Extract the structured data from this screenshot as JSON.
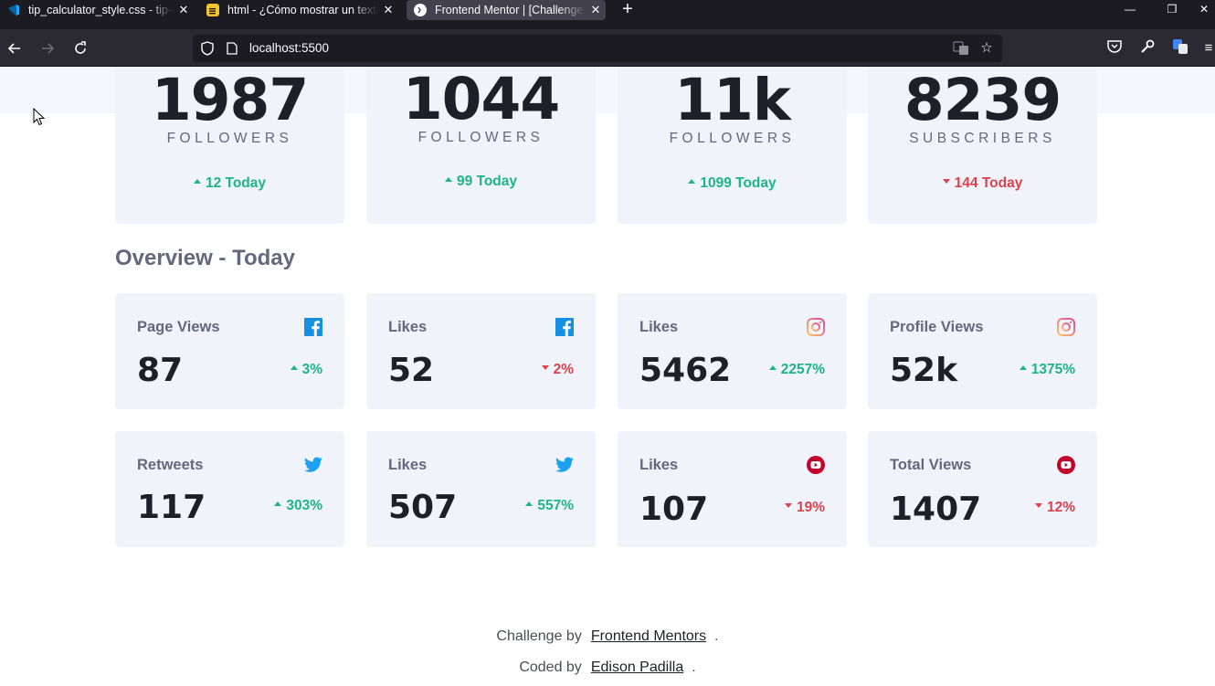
{
  "browser": {
    "tabs": [
      {
        "title": "tip_calculator_style.css - tip-calc",
        "icon": "vscode-icon",
        "active": false
      },
      {
        "title": "html - ¿Cómo mostrar un texto",
        "icon": "stackoverflow-icon",
        "active": false
      },
      {
        "title": "Frontend Mentor | [Challenge N",
        "icon": "frontend-mentor-icon",
        "active": true
      }
    ],
    "url": "localhost:5500"
  },
  "followers": [
    {
      "platform": "facebook",
      "count": "1987",
      "label": "FOLLOWERS",
      "today": "12 Today",
      "trend": "up"
    },
    {
      "platform": "twitter",
      "count": "1044",
      "label": "FOLLOWERS",
      "today": "99 Today",
      "trend": "up"
    },
    {
      "platform": "instagram",
      "count": "11k",
      "label": "FOLLOWERS",
      "today": "1099 Today",
      "trend": "up"
    },
    {
      "platform": "youtube",
      "count": "8239",
      "label": "SUBSCRIBERS",
      "today": "144 Today",
      "trend": "down"
    }
  ],
  "overview": {
    "title": "Overview - Today",
    "cards": [
      {
        "name": "Page Views",
        "platform": "facebook",
        "value": "87",
        "pct": "3%",
        "trend": "up"
      },
      {
        "name": "Likes",
        "platform": "facebook",
        "value": "52",
        "pct": "2%",
        "trend": "down"
      },
      {
        "name": "Likes",
        "platform": "instagram",
        "value": "5462",
        "pct": "2257%",
        "trend": "up"
      },
      {
        "name": "Profile Views",
        "platform": "instagram",
        "value": "52k",
        "pct": "1375%",
        "trend": "up"
      },
      {
        "name": "Retweets",
        "platform": "twitter",
        "value": "117",
        "pct": "303%",
        "trend": "up"
      },
      {
        "name": "Likes",
        "platform": "twitter",
        "value": "507",
        "pct": "557%",
        "trend": "up"
      },
      {
        "name": "Likes",
        "platform": "youtube",
        "value": "107",
        "pct": "19%",
        "trend": "down"
      },
      {
        "name": "Total Views",
        "platform": "youtube",
        "value": "1407",
        "pct": "12%",
        "trend": "down"
      }
    ]
  },
  "footer": {
    "challenge_prefix": "Challenge by",
    "challenge_link": "Frontend Mentors",
    "coded_prefix": "Coded by",
    "coded_link": "Edison Padilla",
    "period": "."
  },
  "colors": {
    "up": "#1db489",
    "down": "#dc414c",
    "card_bg": "#f0f3fa",
    "facebook": "#178fe5",
    "twitter": "#1ca0f2",
    "youtube": "#c4032a"
  }
}
